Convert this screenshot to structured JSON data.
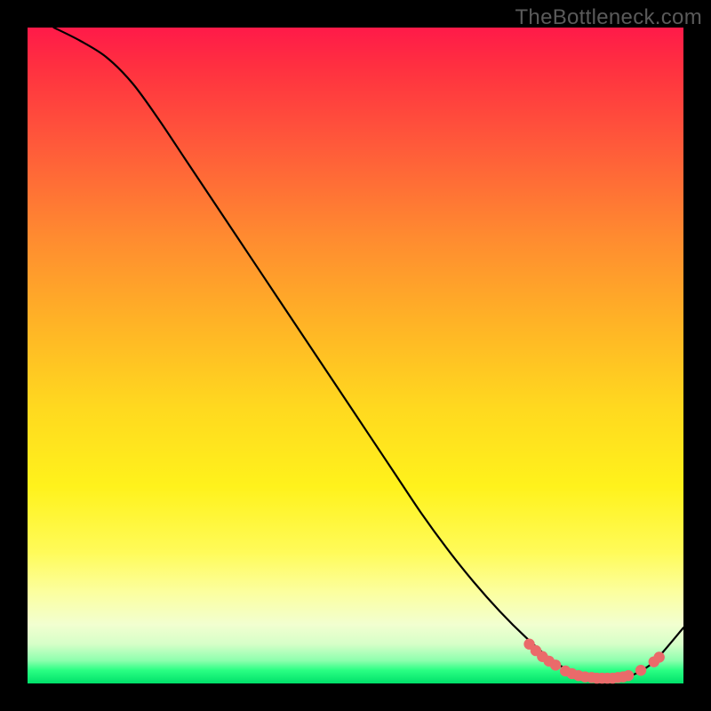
{
  "watermark": "TheBottleneck.com",
  "colors": {
    "background": "#000000",
    "curve": "#000000",
    "marker_fill": "#ea6a6a",
    "marker_stroke": "#b64848",
    "gradient_top": "#ff1a49",
    "gradient_bottom": "#00e06a"
  },
  "chart_data": {
    "type": "line",
    "title": "",
    "xlabel": "",
    "ylabel": "",
    "xlim": [
      0,
      100
    ],
    "ylim": [
      0,
      100
    ],
    "grid": false,
    "legend": false,
    "series": [
      {
        "name": "bottleneck-curve",
        "x": [
          4,
          8,
          12,
          16,
          20,
          24,
          28,
          32,
          36,
          40,
          44,
          48,
          52,
          56,
          60,
          64,
          68,
          72,
          76,
          80,
          82,
          84,
          86,
          88,
          90,
          92,
          94,
          96,
          100
        ],
        "values": [
          100,
          98,
          95.5,
          91.5,
          86,
          80,
          74,
          68,
          62,
          56,
          50,
          44,
          38,
          32,
          26,
          20.5,
          15.5,
          11,
          7,
          3.5,
          2.3,
          1.5,
          1,
          0.8,
          0.8,
          1.2,
          2.2,
          3.8,
          8.5
        ]
      }
    ],
    "markers": [
      {
        "x": 76.5,
        "y": 6.0
      },
      {
        "x": 77.5,
        "y": 5.0
      },
      {
        "x": 78.5,
        "y": 4.1
      },
      {
        "x": 79.5,
        "y": 3.4
      },
      {
        "x": 80.5,
        "y": 2.8
      },
      {
        "x": 82.0,
        "y": 1.9
      },
      {
        "x": 83.0,
        "y": 1.5
      },
      {
        "x": 84.0,
        "y": 1.2
      },
      {
        "x": 85.0,
        "y": 1.0
      },
      {
        "x": 86.0,
        "y": 0.9
      },
      {
        "x": 86.8,
        "y": 0.8
      },
      {
        "x": 87.6,
        "y": 0.8
      },
      {
        "x": 88.4,
        "y": 0.8
      },
      {
        "x": 89.2,
        "y": 0.8
      },
      {
        "x": 90.0,
        "y": 0.9
      },
      {
        "x": 90.8,
        "y": 1.0
      },
      {
        "x": 91.6,
        "y": 1.2
      },
      {
        "x": 93.5,
        "y": 2.0
      },
      {
        "x": 95.5,
        "y": 3.3
      },
      {
        "x": 96.3,
        "y": 4.0
      }
    ]
  }
}
